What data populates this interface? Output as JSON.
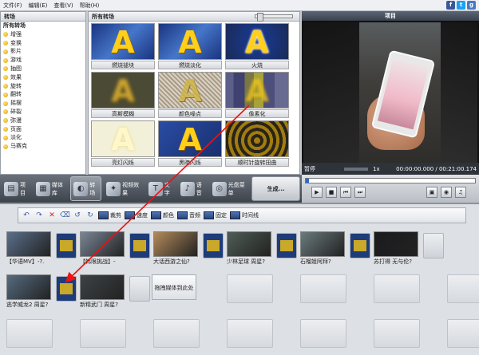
{
  "menu": [
    "文件(F)",
    "编辑(E)",
    "查看(V)",
    "帮助(H)"
  ],
  "social": [
    {
      "label": "f",
      "color": "#3b5998",
      "name": "facebook-icon"
    },
    {
      "label": "t",
      "color": "#1da1f2",
      "name": "twitter-icon"
    },
    {
      "label": "g",
      "color": "#4a78c4",
      "name": "google-plus-icon"
    }
  ],
  "left_panel": {
    "title": "转场",
    "categories": [
      "所有转场",
      "增强",
      "变换",
      "影片",
      "游戏",
      "抽图",
      "效果",
      "旋转",
      "翻转",
      "摇摆",
      "碎裂",
      "弥漫",
      "页面",
      "淡化",
      "马赛克"
    ]
  },
  "mid_panel": {
    "title": "所有转场",
    "tiles": [
      {
        "label": "燃烧褪块",
        "style": "th-fire2"
      },
      {
        "label": "燃烧淡化",
        "style": "th-plain"
      },
      {
        "label": "火烧",
        "style": "th-fire"
      },
      {
        "label": "高斯模糊",
        "style": "th-blur"
      },
      {
        "label": "颜色噪点",
        "style": "th-noise"
      },
      {
        "label": "像素化",
        "style": "th-pixel"
      },
      {
        "label": "亮灯闪烁",
        "style": "th-bright"
      },
      {
        "label": "黑暗闪烁",
        "style": "th-black"
      },
      {
        "label": "顺时针旋转扭曲",
        "style": "th-swirl"
      }
    ]
  },
  "preview": {
    "title": "项目",
    "status": "暂停",
    "speed": "1x",
    "time": "00:00:00.000 / 00:21:00.174"
  },
  "toolbar": {
    "buttons": [
      {
        "label": "项目",
        "name": "project-button",
        "glyph": "▤"
      },
      {
        "label": "媒体库",
        "name": "media-library-button",
        "glyph": "▦"
      },
      {
        "label": "转场",
        "name": "transitions-button",
        "glyph": "◐",
        "active": true
      },
      {
        "label": "视频效果",
        "name": "video-effects-button",
        "glyph": "✦"
      },
      {
        "label": "文字",
        "name": "text-button",
        "glyph": "T"
      },
      {
        "label": "语音",
        "name": "voice-button",
        "glyph": "♪"
      },
      {
        "label": "光盘菜单",
        "name": "disc-menu-button",
        "glyph": "◎"
      }
    ],
    "produce_label": "生成..."
  },
  "timeline_toolbar": {
    "items": [
      {
        "label": "裁剪",
        "name": "crop-button"
      },
      {
        "label": "速度",
        "name": "speed-button"
      },
      {
        "label": "颜色",
        "name": "color-button"
      },
      {
        "label": "音频",
        "name": "audio-button"
      },
      {
        "label": "固定",
        "name": "stabilize-button"
      },
      {
        "label": "时间线",
        "name": "timeline-view-button"
      }
    ]
  },
  "clips_row1": [
    {
      "label": "【华语MV】-?.",
      "bg": "#5a6f8a"
    },
    {
      "label": "【韩限挑战】-",
      "bg": "#7a8696"
    },
    {
      "label": "大话西游之仙?",
      "bg": "#b38a5a"
    },
    {
      "label": "少林足球 周星?",
      "bg": "#4f5d55"
    },
    {
      "label": "石榴姐阿拜?",
      "bg": "#6a7a7d"
    },
    {
      "label": "苏打得 无与伦?",
      "bg": "#1b1b1e"
    }
  ],
  "clips_row2": [
    {
      "label": "逃学威龙2 周星?",
      "bg": "#556a7e"
    },
    {
      "label": "新精武门 周星?",
      "bg": "#3d4246"
    }
  ],
  "drop_text": "拖拽媒体到此处"
}
